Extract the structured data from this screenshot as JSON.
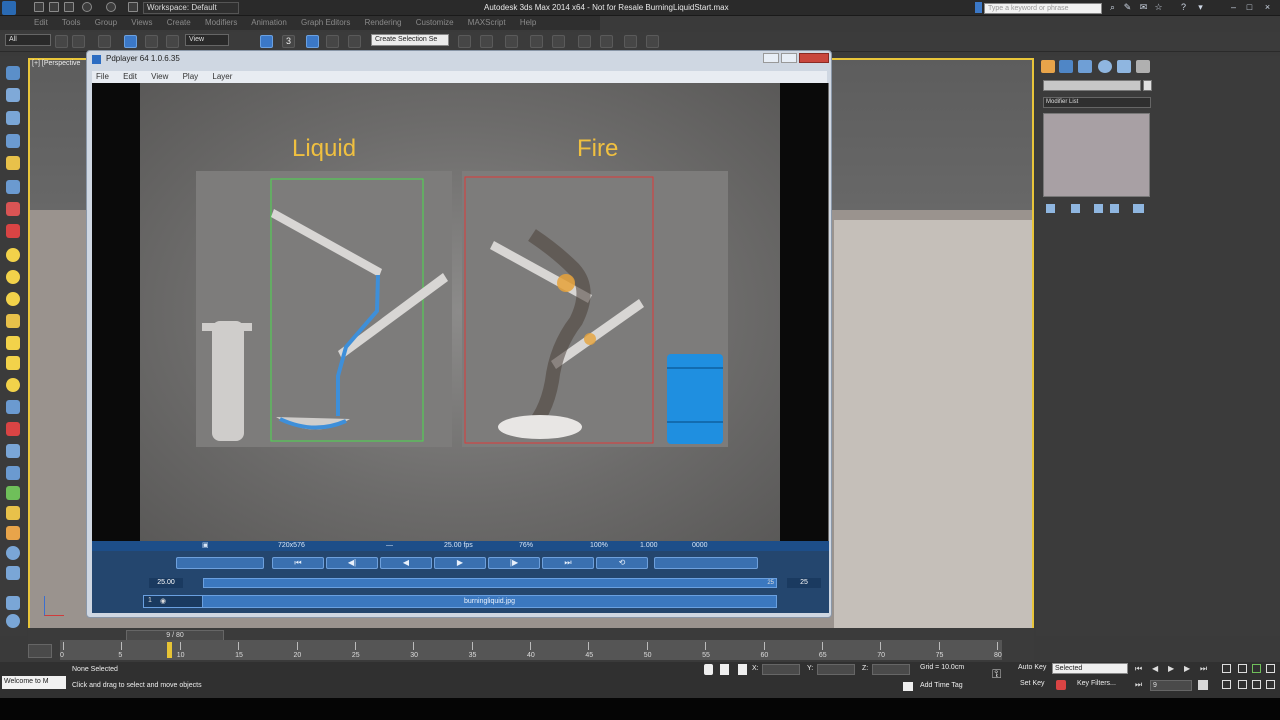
{
  "window": {
    "title": "Autodesk 3ds Max 2014 x64 - Not for Resale   BurningLiquidStart.max",
    "workspace": "Workspace: Default",
    "search_placeholder": "Type a keyword or phrase"
  },
  "menu": [
    "Edit",
    "Tools",
    "Group",
    "Views",
    "Create",
    "Modifiers",
    "Animation",
    "Graph Editors",
    "Rendering",
    "Customize",
    "MAXScript",
    "Help"
  ],
  "toolbar": {
    "filter_value": "All",
    "view_value": "View",
    "selection_set_value": "Create Selection Se",
    "num_3": "3"
  },
  "viewport": {
    "label": "[+] [Perspective"
  },
  "command_panel": {
    "modifier_list": "Modifier List"
  },
  "player": {
    "title": "Pdplayer 64 1.0.6.35",
    "menu": [
      "File",
      "Edit",
      "View",
      "Play",
      "Layer"
    ],
    "labels": {
      "left": "Liquid",
      "right": "Fire"
    },
    "status": {
      "resolution": "720x576",
      "frame_marker": "—",
      "fps": "25.00 fps",
      "zoom": "76%",
      "opacity": "100%",
      "speed": "1.000",
      "frame": "0000"
    },
    "current_time": "25.00",
    "total_frames": "25",
    "seek_end": "25",
    "layer": {
      "index": "1",
      "name": "burningliquid.jpg"
    }
  },
  "timeline": {
    "slider_label": "9 / 80",
    "ticks": [
      "0",
      "5",
      "10",
      "15",
      "20",
      "25",
      "30",
      "35",
      "40",
      "45",
      "50",
      "55",
      "60",
      "65",
      "70",
      "75",
      "80"
    ]
  },
  "status": {
    "maxscript": "Welcome to M",
    "selection": "None Selected",
    "prompt": "Click and drag to select and move objects",
    "x_label": "X:",
    "y_label": "Y:",
    "z_label": "Z:",
    "grid": "Grid = 10.0cm",
    "add_time_tag": "Add Time Tag",
    "auto_key": "Auto Key",
    "set_key": "Set Key",
    "key_mode": "Selected",
    "key_filters": "Key Filters...",
    "frame": "9"
  }
}
